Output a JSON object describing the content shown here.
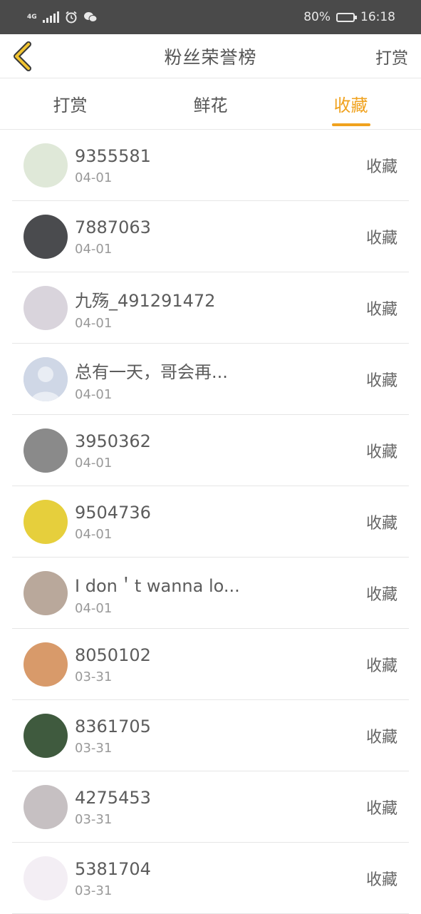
{
  "status_bar": {
    "network": "4G",
    "battery": "80%",
    "battery_level": 0.8,
    "time": "16:18"
  },
  "nav": {
    "title": "粉丝荣誉榜",
    "action_label": "打赏",
    "accent_color": "#f0a21e"
  },
  "tabs": [
    {
      "label": "打赏",
      "active": false
    },
    {
      "label": "鲜花",
      "active": false
    },
    {
      "label": "收藏",
      "active": true
    }
  ],
  "fans": [
    {
      "name": "9355581",
      "date": "04-01",
      "action": "收藏",
      "avatar_color": "#dfe8d8"
    },
    {
      "name": "7887063",
      "date": "04-01",
      "action": "收藏",
      "avatar_color": "#4a4b4e"
    },
    {
      "name": "九殇_491291472",
      "date": "04-01",
      "action": "收藏",
      "avatar_color": "#d9d4dc"
    },
    {
      "name": "总有一天，哥会再...",
      "date": "04-01",
      "action": "收藏",
      "avatar_color": "#cfd7e6"
    },
    {
      "name": "3950362",
      "date": "04-01",
      "action": "收藏",
      "avatar_color": "#8a8a8a"
    },
    {
      "name": "9504736",
      "date": "04-01",
      "action": "收藏",
      "avatar_color": "#e6cf3c"
    },
    {
      "name": "I don＇t wanna lo...",
      "date": "04-01",
      "action": "收藏",
      "avatar_color": "#b9a89b"
    },
    {
      "name": "8050102",
      "date": "03-31",
      "action": "收藏",
      "avatar_color": "#d89a6a"
    },
    {
      "name": "8361705",
      "date": "03-31",
      "action": "收藏",
      "avatar_color": "#3f5a3e"
    },
    {
      "name": "4275453",
      "date": "03-31",
      "action": "收藏",
      "avatar_color": "#c6c0c2"
    },
    {
      "name": "5381704",
      "date": "03-31",
      "action": "收藏",
      "avatar_color": "#f3eef4"
    }
  ]
}
